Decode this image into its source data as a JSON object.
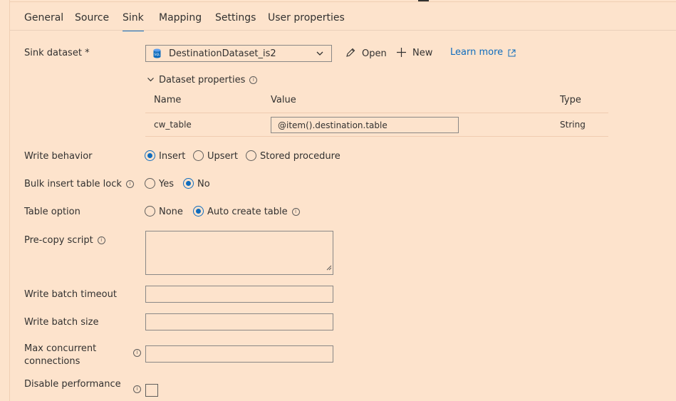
{
  "tabs": [
    "General",
    "Source",
    "Sink",
    "Mapping",
    "Settings",
    "User properties"
  ],
  "active_tab": "Sink",
  "sink_dataset": {
    "label": "Sink dataset",
    "required_mark": "*",
    "value": "DestinationDataset_is2",
    "icon": "sql-database-icon",
    "open_label": "Open",
    "new_label": "New",
    "learn_more_label": "Learn more"
  },
  "dataset_properties": {
    "title": "Dataset properties",
    "columns": {
      "name": "Name",
      "value": "Value",
      "type": "Type"
    },
    "rows": [
      {
        "name": "cw_table",
        "value": "@item().destination.table",
        "type": "String"
      }
    ]
  },
  "write_behavior": {
    "label": "Write behavior",
    "options": [
      "Insert",
      "Upsert",
      "Stored procedure"
    ],
    "selected": "Insert"
  },
  "bulk_insert_table_lock": {
    "label": "Bulk insert table lock",
    "options": [
      "Yes",
      "No"
    ],
    "selected": "No"
  },
  "table_option": {
    "label": "Table option",
    "options": [
      "None",
      "Auto create table"
    ],
    "selected": "Auto create table"
  },
  "pre_copy_script": {
    "label": "Pre-copy script",
    "value": ""
  },
  "write_batch_timeout": {
    "label": "Write batch timeout",
    "value": ""
  },
  "write_batch_size": {
    "label": "Write batch size",
    "value": ""
  },
  "max_concurrent_connections": {
    "label_line1": "Max concurrent",
    "label_line2": "connections",
    "value": ""
  },
  "disable_performance": {
    "label": "Disable performance",
    "checked": false
  },
  "colors": {
    "background": "#fde3cc",
    "accent": "#0f6cbd",
    "text": "#323130",
    "border": "#8a8886"
  }
}
